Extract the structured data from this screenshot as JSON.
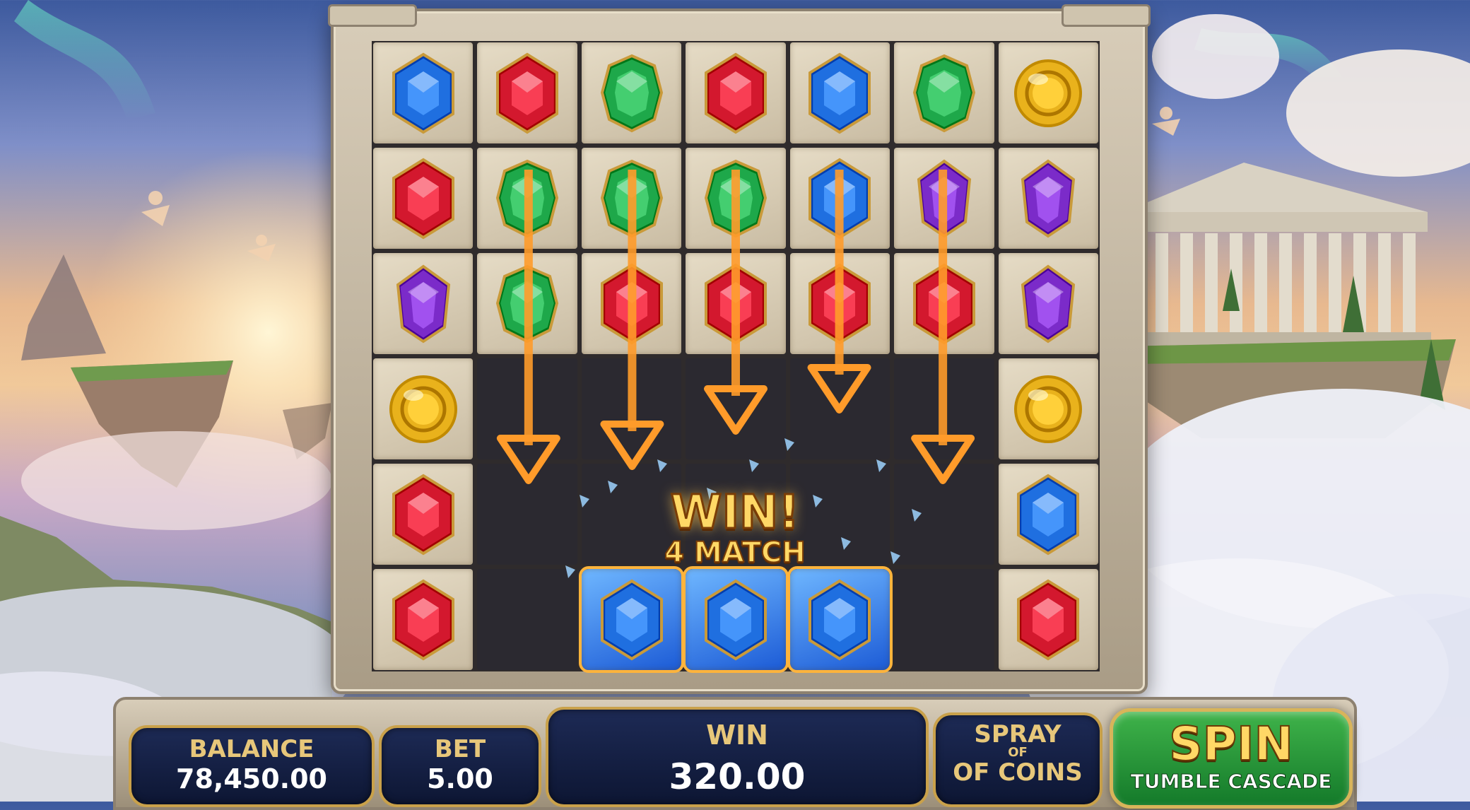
{
  "hud": {
    "balance_label": "BALANCE",
    "balance_value": "78,450.00",
    "bet_label": "BET",
    "bet_value": "5.00",
    "win_label": "WIN",
    "win_value": "320.00",
    "spray_line1": "SPRAY",
    "spray_line2": "OF",
    "spray_line3": "OF COINS",
    "spin_label": "SPIN",
    "spin_sublabel": "TUMBLE CASCADE"
  },
  "win_banner": {
    "title": "WIN!",
    "subtitle": "4 MATCH"
  },
  "grid": {
    "columns": 7,
    "rows": [
      [
        "blue",
        "red",
        "green",
        "red",
        "blue",
        "green",
        "coin"
      ],
      [
        "red",
        "green",
        "green",
        "green",
        "blue",
        "purple",
        "purple"
      ],
      [
        "purple",
        "green",
        "red",
        "red",
        "red",
        "red",
        "purple"
      ],
      [
        "coin",
        "",
        "",
        "",
        "",
        "",
        "coin"
      ],
      [
        "red",
        "",
        "",
        "",
        "",
        "",
        "blue"
      ],
      [
        "red",
        "",
        "blue",
        "blue",
        "blue",
        "",
        "red"
      ]
    ],
    "matched_cells": [
      "5-2",
      "5-3",
      "5-4"
    ],
    "falling_columns": [
      1,
      2,
      3,
      4,
      5
    ]
  },
  "symbol_colors": {
    "blue": "#1f6fe0",
    "red": "#d3182e",
    "green": "#1ea84a",
    "purple": "#7b2bc9",
    "coin": "#e9b21c"
  },
  "accent_colors": {
    "arrow": "#ff9b2a",
    "frame_gold": "#c9a14a",
    "panel_navy": "#14214a",
    "spin_green": "#2f9e3e"
  }
}
